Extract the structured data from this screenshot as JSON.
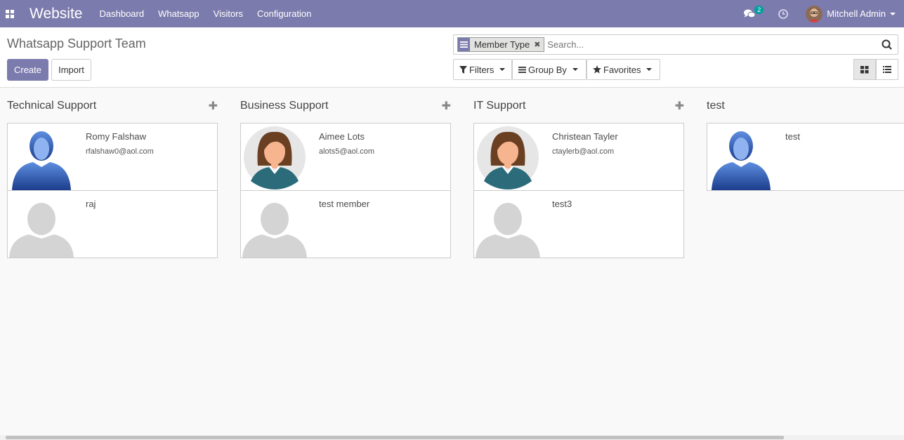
{
  "navbar": {
    "brand": "Website",
    "menu": [
      "Dashboard",
      "Whatsapp",
      "Visitors",
      "Configuration"
    ],
    "chat_badge": "2",
    "user_name": "Mitchell Admin",
    "bg_color": "#7c7bad"
  },
  "control": {
    "title": "Whatsapp Support Team",
    "create_label": "Create",
    "import_label": "Import",
    "search": {
      "facet_label": "Member Type",
      "placeholder": "Search..."
    },
    "filters_label": "Filters",
    "groupby_label": "Group By",
    "favorites_label": "Favorites"
  },
  "columns": [
    {
      "title": "Technical Support",
      "cards": [
        {
          "name": "Romy Falshaw",
          "email": "rfalshaw0@aol.com",
          "avatar": "male-blue-icon"
        },
        {
          "name": "raj",
          "email": "",
          "avatar": "placeholder-person-icon"
        }
      ]
    },
    {
      "title": "Business Support",
      "cards": [
        {
          "name": "Aimee Lots",
          "email": "alots5@aol.com",
          "avatar": "female-icon"
        },
        {
          "name": "test member",
          "email": "",
          "avatar": "placeholder-person-icon"
        }
      ]
    },
    {
      "title": "IT Support",
      "cards": [
        {
          "name": "Christean Tayler",
          "email": "ctaylerb@aol.com",
          "avatar": "female-icon"
        },
        {
          "name": "test3",
          "email": "",
          "avatar": "placeholder-person-icon"
        }
      ]
    },
    {
      "title": "test",
      "cards": [
        {
          "name": "test",
          "email": "",
          "avatar": "male-blue-icon"
        }
      ]
    }
  ]
}
